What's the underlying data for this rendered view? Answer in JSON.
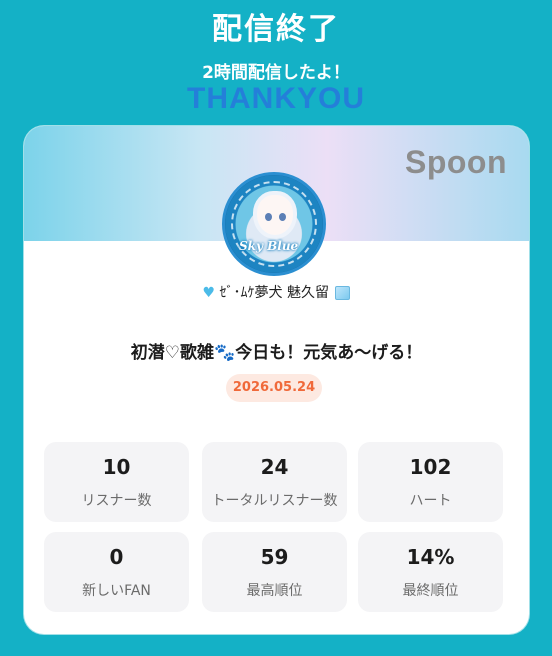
{
  "header": {
    "title": "配信終了",
    "subtitle": "2時間配信したよ！",
    "thanks": "THANKYOU"
  },
  "card": {
    "brand": "Spoon",
    "avatar": {
      "logo_text": "Sky Blue"
    },
    "user": {
      "prefix_icon": "blue-heart-icon",
      "name": "ｾﾞ･ﾑｹ夢犬 魅久留",
      "suffix_icon": "ice-cube-icon"
    },
    "stream_title": "初潜♡歌雑🐾今日も！元気あ〜げる！",
    "date": "2026.05.24",
    "stats": [
      {
        "value": "10",
        "label": "リスナー数"
      },
      {
        "value": "24",
        "label": "トータルリスナー数"
      },
      {
        "value": "102",
        "label": "ハート"
      },
      {
        "value": "0",
        "label": "新しいFAN"
      },
      {
        "value": "59",
        "label": "最高順位"
      },
      {
        "value": "14%",
        "label": "最終順位"
      }
    ]
  },
  "colors": {
    "background": "#14b1c6",
    "date_text": "#f0693a",
    "date_bg": "#fde9e1",
    "stat_bg": "#f4f4f6"
  }
}
